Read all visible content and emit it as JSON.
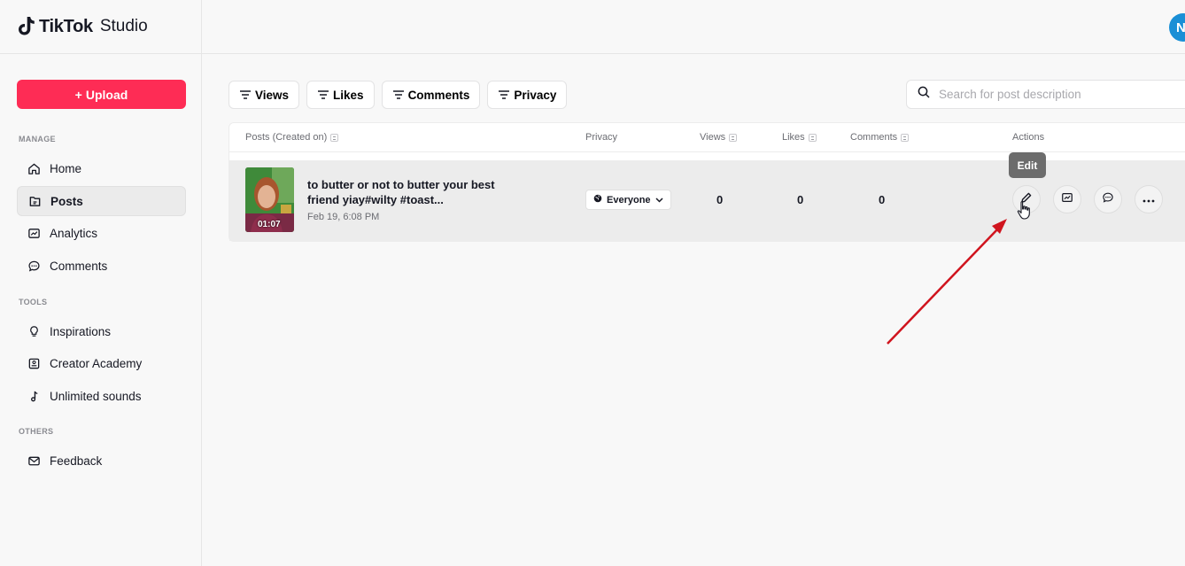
{
  "brand": {
    "name": "TikTok",
    "product": "Studio"
  },
  "avatar_initial": "N",
  "upload_label": "Upload",
  "sidebar": {
    "sections": [
      {
        "label": "MANAGE"
      },
      {
        "label": "TOOLS"
      },
      {
        "label": "OTHERS"
      }
    ],
    "items": [
      {
        "label": "Home",
        "icon": "home-icon"
      },
      {
        "label": "Posts",
        "icon": "posts-icon",
        "active": true
      },
      {
        "label": "Analytics",
        "icon": "analytics-icon"
      },
      {
        "label": "Comments",
        "icon": "comments-icon"
      },
      {
        "label": "Inspirations",
        "icon": "lightbulb-icon"
      },
      {
        "label": "Creator Academy",
        "icon": "academy-icon"
      },
      {
        "label": "Unlimited sounds",
        "icon": "music-note-icon"
      },
      {
        "label": "Feedback",
        "icon": "mail-icon"
      }
    ]
  },
  "filters": [
    {
      "label": "Views"
    },
    {
      "label": "Likes"
    },
    {
      "label": "Comments"
    },
    {
      "label": "Privacy"
    }
  ],
  "search": {
    "placeholder": "Search for post description"
  },
  "table": {
    "headers": {
      "posts": "Posts (Created on)",
      "privacy": "Privacy",
      "views": "Views",
      "likes": "Likes",
      "comments": "Comments",
      "actions": "Actions"
    },
    "rows": [
      {
        "duration": "01:07",
        "title": "to butter or not to butter your best friend yiay#wilty #toast...",
        "date": "Feb 19, 6:08 PM",
        "privacy": "Everyone",
        "views": "0",
        "likes": "0",
        "comments": "0"
      }
    ]
  },
  "tooltip": "Edit",
  "colors": {
    "accent": "#fe2c55",
    "avatar": "#1a8fd6",
    "annotation_arrow": "#d0141e"
  }
}
